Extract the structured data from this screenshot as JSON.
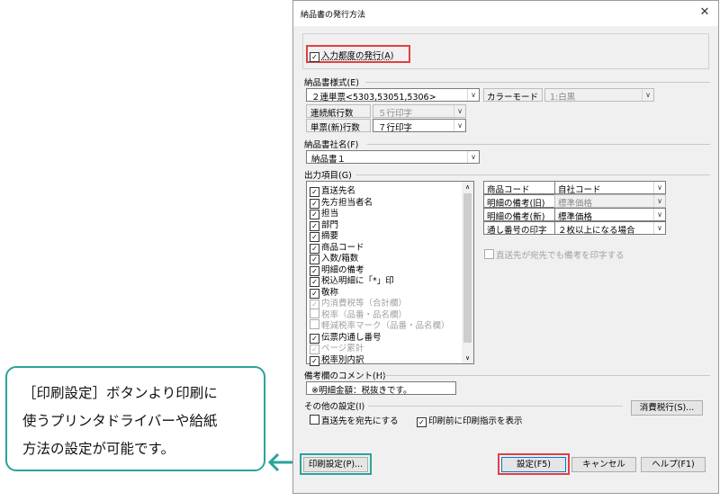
{
  "dialog": {
    "title": "納品書の発行方法",
    "close_glyph": "✕"
  },
  "issue_each_input": {
    "label": "入力都度の発行(A)",
    "checked": true
  },
  "format": {
    "label": "納品書様式(E)",
    "value": "２連単票<5303,53051,5306>",
    "color_mode_label": "カラーモード",
    "color_mode_value": "1:白黒",
    "continuous_rows_label": "連続紙行数",
    "continuous_rows_value": "５行印字",
    "single_rows_label": "単票(新)行数",
    "single_rows_value": "７行印字"
  },
  "company": {
    "label": "納品書社名(F)",
    "value": "納品書１"
  },
  "output_items": {
    "label": "出力項目(G)",
    "items": [
      {
        "label": "直送先名",
        "checked": true,
        "enabled": true
      },
      {
        "label": "先方担当者名",
        "checked": true,
        "enabled": true
      },
      {
        "label": "担当",
        "checked": true,
        "enabled": true
      },
      {
        "label": "部門",
        "checked": true,
        "enabled": true
      },
      {
        "label": "摘要",
        "checked": true,
        "enabled": true
      },
      {
        "label": "商品コード",
        "checked": true,
        "enabled": true
      },
      {
        "label": "入数/箱数",
        "checked": true,
        "enabled": true
      },
      {
        "label": "明細の備考",
        "checked": true,
        "enabled": true
      },
      {
        "label": "税込明細に「*」印",
        "checked": true,
        "enabled": true
      },
      {
        "label": "敬称",
        "checked": true,
        "enabled": true
      },
      {
        "label": "内消費税等（合計欄）",
        "checked": true,
        "enabled": false
      },
      {
        "label": "税率（品番・品名欄）",
        "checked": false,
        "enabled": false
      },
      {
        "label": "軽減税率マーク（品番・品名欄）",
        "checked": false,
        "enabled": false
      },
      {
        "label": "伝票内通し番号",
        "checked": true,
        "enabled": true
      },
      {
        "label": "ページ累計",
        "checked": true,
        "enabled": false
      },
      {
        "label": "税率別内訳",
        "checked": true,
        "enabled": true
      }
    ]
  },
  "settings_grid": [
    {
      "name": "商品コード",
      "value": "自社コード",
      "enabled": true
    },
    {
      "name": "明細の備考(旧)",
      "value": "標準価格",
      "enabled": false
    },
    {
      "name": "明細の備考(新)",
      "value": "標準価格",
      "enabled": true
    },
    {
      "name": "通し番号の印字",
      "value": "２枚以上になる場合",
      "enabled": true
    }
  ],
  "direct_remark": {
    "label": "直送先が宛先でも備考を印字する",
    "checked": false
  },
  "remark_comment": {
    "label": "備考欄のコメント(H)",
    "value": "※明細金額：税抜きです。"
  },
  "other": {
    "label": "その他の設定(I)",
    "direct_to": {
      "label": "直送先を宛先にする",
      "checked": false
    },
    "print_confirm": {
      "label": "印刷前に印刷指示を表示",
      "checked": true
    },
    "tax_button": "消費税行(S)..."
  },
  "buttons": {
    "print_setup": "印刷設定(P)...",
    "ok": "設定(F5)",
    "cancel": "キャンセル",
    "help": "ヘルプ(F1)"
  },
  "callout": {
    "lines": [
      "［印刷設定］ボタンより印刷に",
      "使うプリンタドライバーや給紙",
      "方法の設定が可能です。"
    ]
  },
  "colors": {
    "highlight_red": "#e04040",
    "callout_teal": "#2aa39b"
  },
  "icons": {
    "check": "☑",
    "arrow": "←"
  }
}
